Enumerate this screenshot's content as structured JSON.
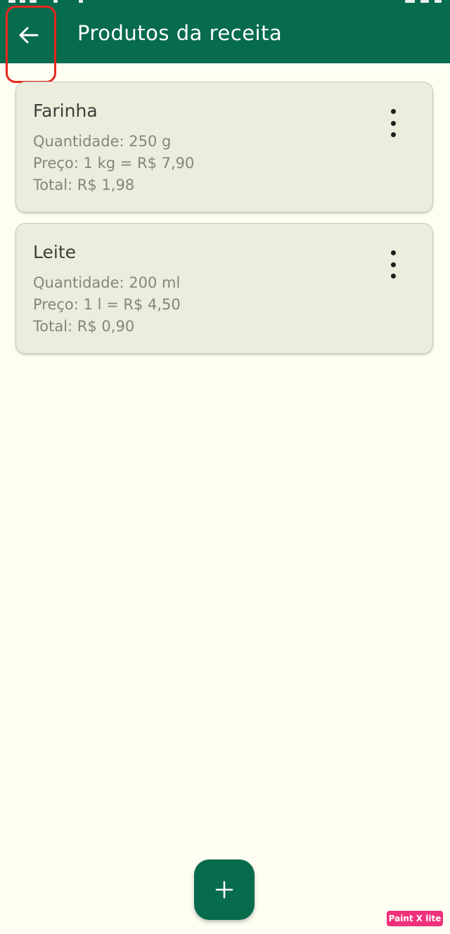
{
  "app_bar": {
    "title": "Produtos da receita",
    "back_icon": "arrow-left-icon",
    "color": "#076b4d"
  },
  "products": [
    {
      "name": "Farinha",
      "quantity": "Quantidade: 250 g",
      "price": "Preço: 1 kg = R$ 7,90",
      "total": "Total: R$ 1,98",
      "menu_icon": "more-vertical-icon"
    },
    {
      "name": "Leite",
      "quantity": "Quantidade: 200 ml",
      "price": "Preço: 1 l = R$ 4,50",
      "total": "Total: R$ 0,90",
      "menu_icon": "more-vertical-icon"
    }
  ],
  "fab": {
    "icon": "plus-icon"
  },
  "annotation": {
    "highlight_color": "#e8261e"
  },
  "watermark": {
    "text": "Paint X lite"
  }
}
